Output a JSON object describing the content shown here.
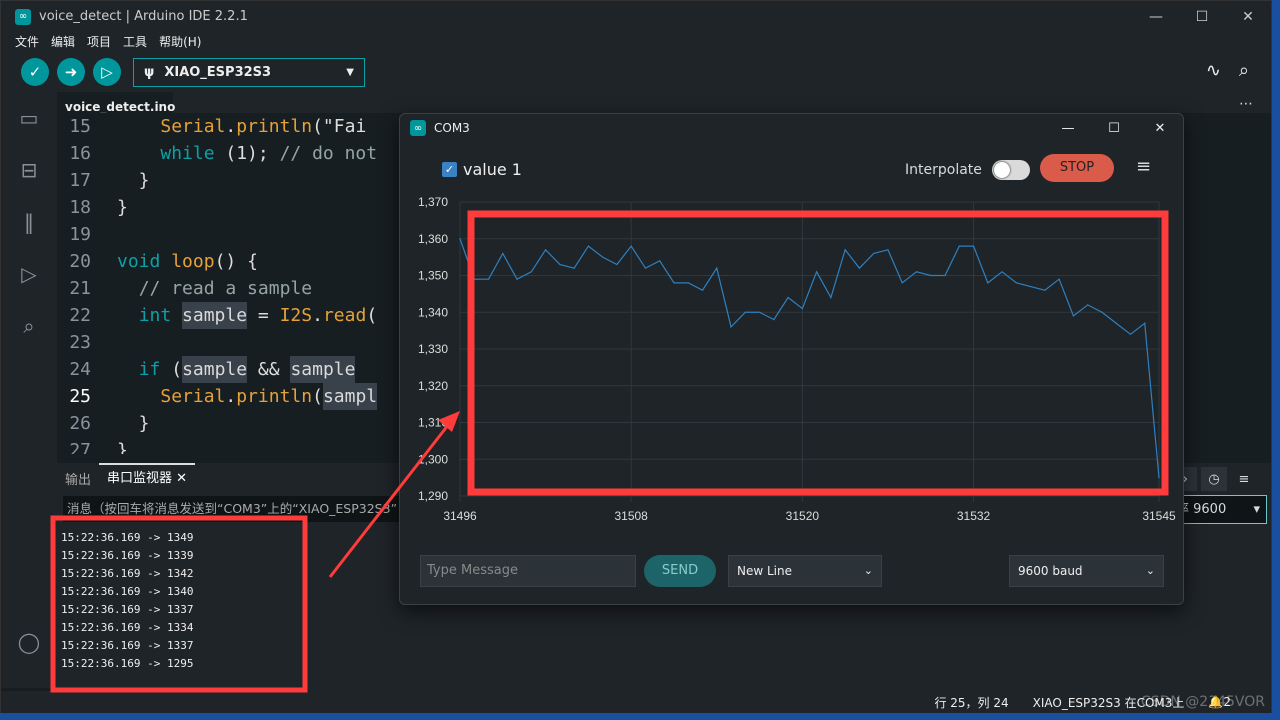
{
  "window": {
    "title": "voice_detect | Arduino IDE 2.2.1",
    "minimize": "—",
    "maximize": "☐",
    "close": "✕"
  },
  "menu": [
    "文件",
    "编辑",
    "项目",
    "工具",
    "帮助(H)"
  ],
  "toolbar": {
    "board": "XIAO_ESP32S3"
  },
  "editor": {
    "tab": "voice_detect.ino",
    "current_line": 25,
    "lines": [
      {
        "n": "15",
        "parts": [
          [
            "pl",
            "    "
          ],
          [
            "fn",
            "Serial"
          ],
          [
            "pl",
            "."
          ],
          [
            "fn",
            "println"
          ],
          [
            "pl",
            "(\"Fai"
          ]
        ]
      },
      {
        "n": "16",
        "parts": [
          [
            "pl",
            "    "
          ],
          [
            "kw",
            "while"
          ],
          [
            "pl",
            " (1); "
          ],
          [
            "cm",
            "// do not"
          ]
        ]
      },
      {
        "n": "17",
        "parts": [
          [
            "pl",
            "  }"
          ]
        ]
      },
      {
        "n": "18",
        "parts": [
          [
            "pl",
            "}"
          ]
        ]
      },
      {
        "n": "19",
        "parts": []
      },
      {
        "n": "20",
        "parts": [
          [
            "kw",
            "void"
          ],
          [
            "pl",
            " "
          ],
          [
            "fn",
            "loop"
          ],
          [
            "pl",
            "() {"
          ]
        ]
      },
      {
        "n": "21",
        "parts": [
          [
            "pl",
            "  "
          ],
          [
            "cm",
            "// read a sample"
          ]
        ]
      },
      {
        "n": "22",
        "parts": [
          [
            "pl",
            "  "
          ],
          [
            "kw",
            "int"
          ],
          [
            "pl",
            " "
          ],
          [
            "hl",
            "sample"
          ],
          [
            "pl",
            " = "
          ],
          [
            "fn",
            "I2S"
          ],
          [
            "pl",
            "."
          ],
          [
            "fn",
            "read"
          ],
          [
            "pl",
            "("
          ]
        ]
      },
      {
        "n": "23",
        "parts": []
      },
      {
        "n": "24",
        "parts": [
          [
            "pl",
            "  "
          ],
          [
            "kw",
            "if"
          ],
          [
            "pl",
            " ("
          ],
          [
            "hl",
            "sample"
          ],
          [
            "pl",
            " && "
          ],
          [
            "hl",
            "sample"
          ]
        ]
      },
      {
        "n": "25",
        "parts": [
          [
            "pl",
            "    "
          ],
          [
            "fn",
            "Serial"
          ],
          [
            "pl",
            "."
          ],
          [
            "fn",
            "println"
          ],
          [
            "pl",
            "("
          ],
          [
            "hl",
            "sampl"
          ]
        ]
      },
      {
        "n": "26",
        "parts": [
          [
            "pl",
            "  }"
          ]
        ]
      },
      {
        "n": "27",
        "parts": [
          [
            "pl",
            "}"
          ]
        ]
      }
    ]
  },
  "bottom": {
    "tab_output": "输出",
    "tab_serial": "串口监视器",
    "message_placeholder": "消息（按回车将消息发送到“COM3”上的“XIAO_ESP32S3”",
    "baud": "率 9600",
    "log": [
      "15:22:36.169 -> 1349",
      "15:22:36.169 -> 1339",
      "15:22:36.169 -> 1342",
      "15:22:36.169 -> 1340",
      "15:22:36.169 -> 1337",
      "15:22:36.169 -> 1334",
      "15:22:36.169 -> 1337",
      "15:22:36.169 -> 1295"
    ]
  },
  "status": {
    "position": "行 25，列 24",
    "board": "XIAO_ESP32S3 在COM3上",
    "notifications": "2",
    "watermark": "CSDN @2345VOR"
  },
  "plotter": {
    "title": "COM3",
    "series_label": "value 1",
    "interpolate": "Interpolate",
    "interpolate_on": false,
    "stop": "STOP",
    "message_placeholder": "Type Message",
    "send": "SEND",
    "line_ending": "New Line",
    "baud": "9600 baud"
  },
  "chart_data": {
    "type": "line",
    "x_start": 31496,
    "x_end": 31545,
    "xticks": [
      31496,
      31508,
      31520,
      31532,
      31545
    ],
    "ylim": [
      1290,
      1370
    ],
    "yticks": [
      1290,
      1300,
      1310,
      1320,
      1330,
      1340,
      1350,
      1360,
      1370
    ],
    "ytick_labels": [
      "1,290",
      "1,300",
      "1,310",
      "1,320",
      "1,330",
      "1,340",
      "1,350",
      "1,360",
      "1,370"
    ],
    "grid": true,
    "color": "#2f80c0",
    "series": [
      {
        "name": "value 1",
        "values": [
          1360,
          1349,
          1349,
          1356,
          1349,
          1351,
          1357,
          1353,
          1352,
          1358,
          1355,
          1353,
          1358,
          1352,
          1354,
          1348,
          1348,
          1346,
          1352,
          1336,
          1340,
          1340,
          1338,
          1344,
          1341,
          1351,
          1344,
          1357,
          1352,
          1356,
          1357,
          1348,
          1351,
          1350,
          1350,
          1358,
          1358,
          1348,
          1351,
          1348,
          1347,
          1346,
          1349,
          1339,
          1342,
          1340,
          1337,
          1334,
          1337,
          1295
        ]
      }
    ]
  },
  "colors": {
    "accent": "#00979c",
    "annotation": "#ff3b3b"
  }
}
